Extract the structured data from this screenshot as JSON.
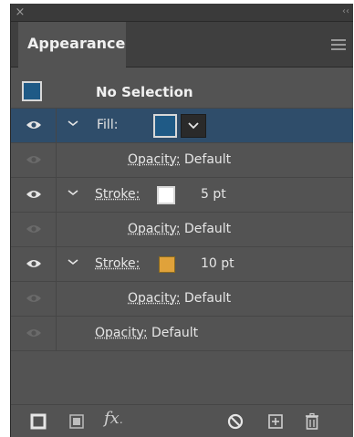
{
  "window": {
    "close_glyph": "×",
    "collapse_glyph": "‹‹"
  },
  "tab": {
    "label": "Appearance"
  },
  "selection": {
    "title": "No Selection",
    "swatch_color": "#1f5a86"
  },
  "rows": [
    {
      "kind": "fill",
      "label": "Fill:",
      "swatch_color": "#1f5a86",
      "visible": true,
      "selected": true
    },
    {
      "kind": "opacity",
      "label": "Opacity:",
      "value": "Default"
    },
    {
      "kind": "stroke",
      "label": "Stroke:",
      "swatch_color": "#ffffff",
      "weight": "5 pt",
      "visible": true
    },
    {
      "kind": "opacity",
      "label": "Opacity:",
      "value": "Default"
    },
    {
      "kind": "stroke",
      "label": "Stroke:",
      "swatch_color": "#e0a23a",
      "weight": "10 pt",
      "visible": true
    },
    {
      "kind": "opacity",
      "label": "Opacity:",
      "value": "Default"
    },
    {
      "kind": "opacity",
      "label": "Opacity:",
      "value": "Default"
    }
  ],
  "footer": {
    "icons": [
      "add-new-stroke-icon",
      "add-new-fill-icon",
      "add-new-effect-icon",
      "clear-appearance-icon",
      "duplicate-item-icon",
      "delete-item-icon"
    ],
    "fx_label": "fx",
    "fx_dot": "."
  },
  "colors": {
    "panel_bg": "#535353",
    "selected_row": "#2f4d6a",
    "accent_blue": "#1f5a86"
  }
}
